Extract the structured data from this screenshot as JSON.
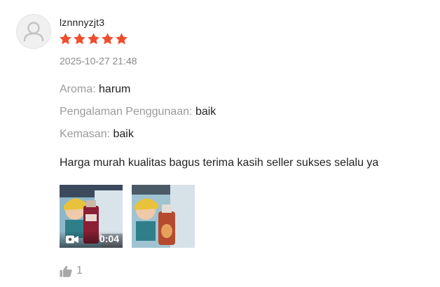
{
  "review": {
    "username": "lznnnyzjt3",
    "rating": 5,
    "timestamp": "2025-10-27 21:48",
    "attributes": [
      {
        "key": "Aroma:",
        "value": "harum"
      },
      {
        "key": "Pengalaman Penggunaan:",
        "value": "baik"
      },
      {
        "key": "Kemasan:",
        "value": "baik"
      }
    ],
    "comment": "Harga murah kualitas bagus terima kasih seller sukses selalu ya",
    "media": {
      "video_duration": "0:04",
      "video_icon": "video-camera-icon"
    },
    "likes": "1",
    "like_icon": "thumbs-up-icon"
  },
  "colors": {
    "star": "#ee4d2d",
    "muted_text": "#9a9a9a",
    "main_text": "#222222"
  }
}
